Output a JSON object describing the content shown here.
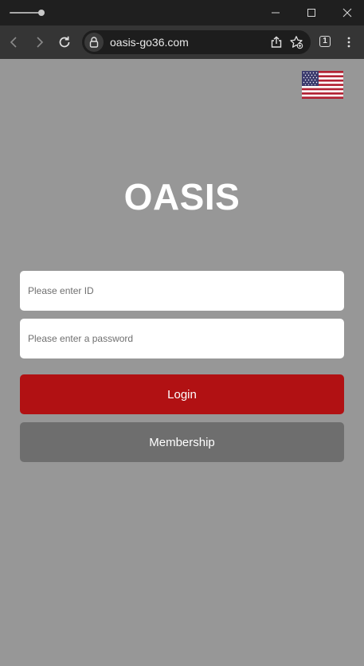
{
  "browser": {
    "url": "oasis-go36.com",
    "tab_count": "1"
  },
  "page": {
    "logo": "OASIS",
    "language_icon": "us-flag-icon",
    "login_form": {
      "id_placeholder": "Please enter ID",
      "password_placeholder": "Please enter a password",
      "login_label": "Login",
      "membership_label": "Membership"
    }
  },
  "colors": {
    "page_background": "#979797",
    "login_button": "#b11113",
    "membership_button": "#6e6e6e",
    "flag_red": "#b22234",
    "flag_blue": "#3c3b6e"
  }
}
